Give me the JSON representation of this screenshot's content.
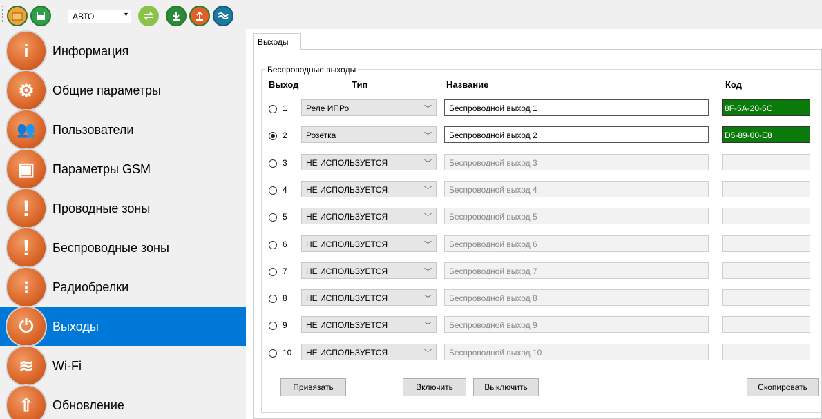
{
  "toolbar": {
    "mode_value": "АВТО",
    "icons": [
      "folder-open-icon",
      "save-icon",
      "transfer-icon",
      "download-icon",
      "upload-icon",
      "connect-icon"
    ]
  },
  "sidebar": {
    "items": [
      {
        "label": "Информация",
        "icon": "info-icon",
        "glyph": "i"
      },
      {
        "label": "Общие параметры",
        "icon": "wrench-icon",
        "glyph": "⚙"
      },
      {
        "label": "Пользователи",
        "icon": "users-icon",
        "glyph": "👥"
      },
      {
        "label": "Параметры GSM",
        "icon": "sim-card-icon",
        "glyph": "▣"
      },
      {
        "label": "Проводные зоны",
        "icon": "wired-zone-icon",
        "glyph": "!"
      },
      {
        "label": "Беспроводные зоны",
        "icon": "wireless-zone-icon",
        "glyph": "!"
      },
      {
        "label": "Радиобрелки",
        "icon": "keyfob-icon",
        "glyph": "⁝"
      },
      {
        "label": "Выходы",
        "icon": "outputs-icon",
        "glyph": "⏻"
      },
      {
        "label": "Wi-Fi",
        "icon": "wifi-icon",
        "glyph": "≋"
      },
      {
        "label": "Обновление",
        "icon": "update-icon",
        "glyph": "⇧"
      }
    ],
    "active_index": 7
  },
  "tab": {
    "label": "Выходы"
  },
  "group": {
    "title": "Беспроводные выходы"
  },
  "columns": {
    "output": "Выход",
    "type": "Тип",
    "name": "Название",
    "code": "Код"
  },
  "rows": [
    {
      "num": "1",
      "type": "Реле ИПРо",
      "name": "Беспроводной выход 1",
      "code": "8F-5A-20-5C",
      "checked": false,
      "enabled": true
    },
    {
      "num": "2",
      "type": "Розетка",
      "name": "Беспроводной выход 2",
      "code": "D5-89-00-E8",
      "checked": true,
      "enabled": true
    },
    {
      "num": "3",
      "type": "НЕ ИСПОЛЬЗУЕТСЯ",
      "name": "Беспроводной выход 3",
      "code": "",
      "checked": false,
      "enabled": false
    },
    {
      "num": "4",
      "type": "НЕ ИСПОЛЬЗУЕТСЯ",
      "name": "Беспроводной выход 4",
      "code": "",
      "checked": false,
      "enabled": false
    },
    {
      "num": "5",
      "type": "НЕ ИСПОЛЬЗУЕТСЯ",
      "name": "Беспроводной выход 5",
      "code": "",
      "checked": false,
      "enabled": false
    },
    {
      "num": "6",
      "type": "НЕ ИСПОЛЬЗУЕТСЯ",
      "name": "Беспроводной выход 6",
      "code": "",
      "checked": false,
      "enabled": false
    },
    {
      "num": "7",
      "type": "НЕ ИСПОЛЬЗУЕТСЯ",
      "name": "Беспроводной выход 7",
      "code": "",
      "checked": false,
      "enabled": false
    },
    {
      "num": "8",
      "type": "НЕ ИСПОЛЬЗУЕТСЯ",
      "name": "Беспроводной выход 8",
      "code": "",
      "checked": false,
      "enabled": false
    },
    {
      "num": "9",
      "type": "НЕ ИСПОЛЬЗУЕТСЯ",
      "name": "Беспроводной выход 9",
      "code": "",
      "checked": false,
      "enabled": false
    },
    {
      "num": "10",
      "type": "НЕ ИСПОЛЬЗУЕТСЯ",
      "name": "Беспроводной выход 10",
      "code": "",
      "checked": false,
      "enabled": false
    }
  ],
  "buttons": {
    "bind": "Привязать",
    "on": "Включить",
    "off": "Выключить",
    "copy": "Скопировать"
  },
  "colors": {
    "accent": "#0078d7",
    "code_active": "#0a7a0a",
    "icon_orange": "#dd6a2d"
  }
}
